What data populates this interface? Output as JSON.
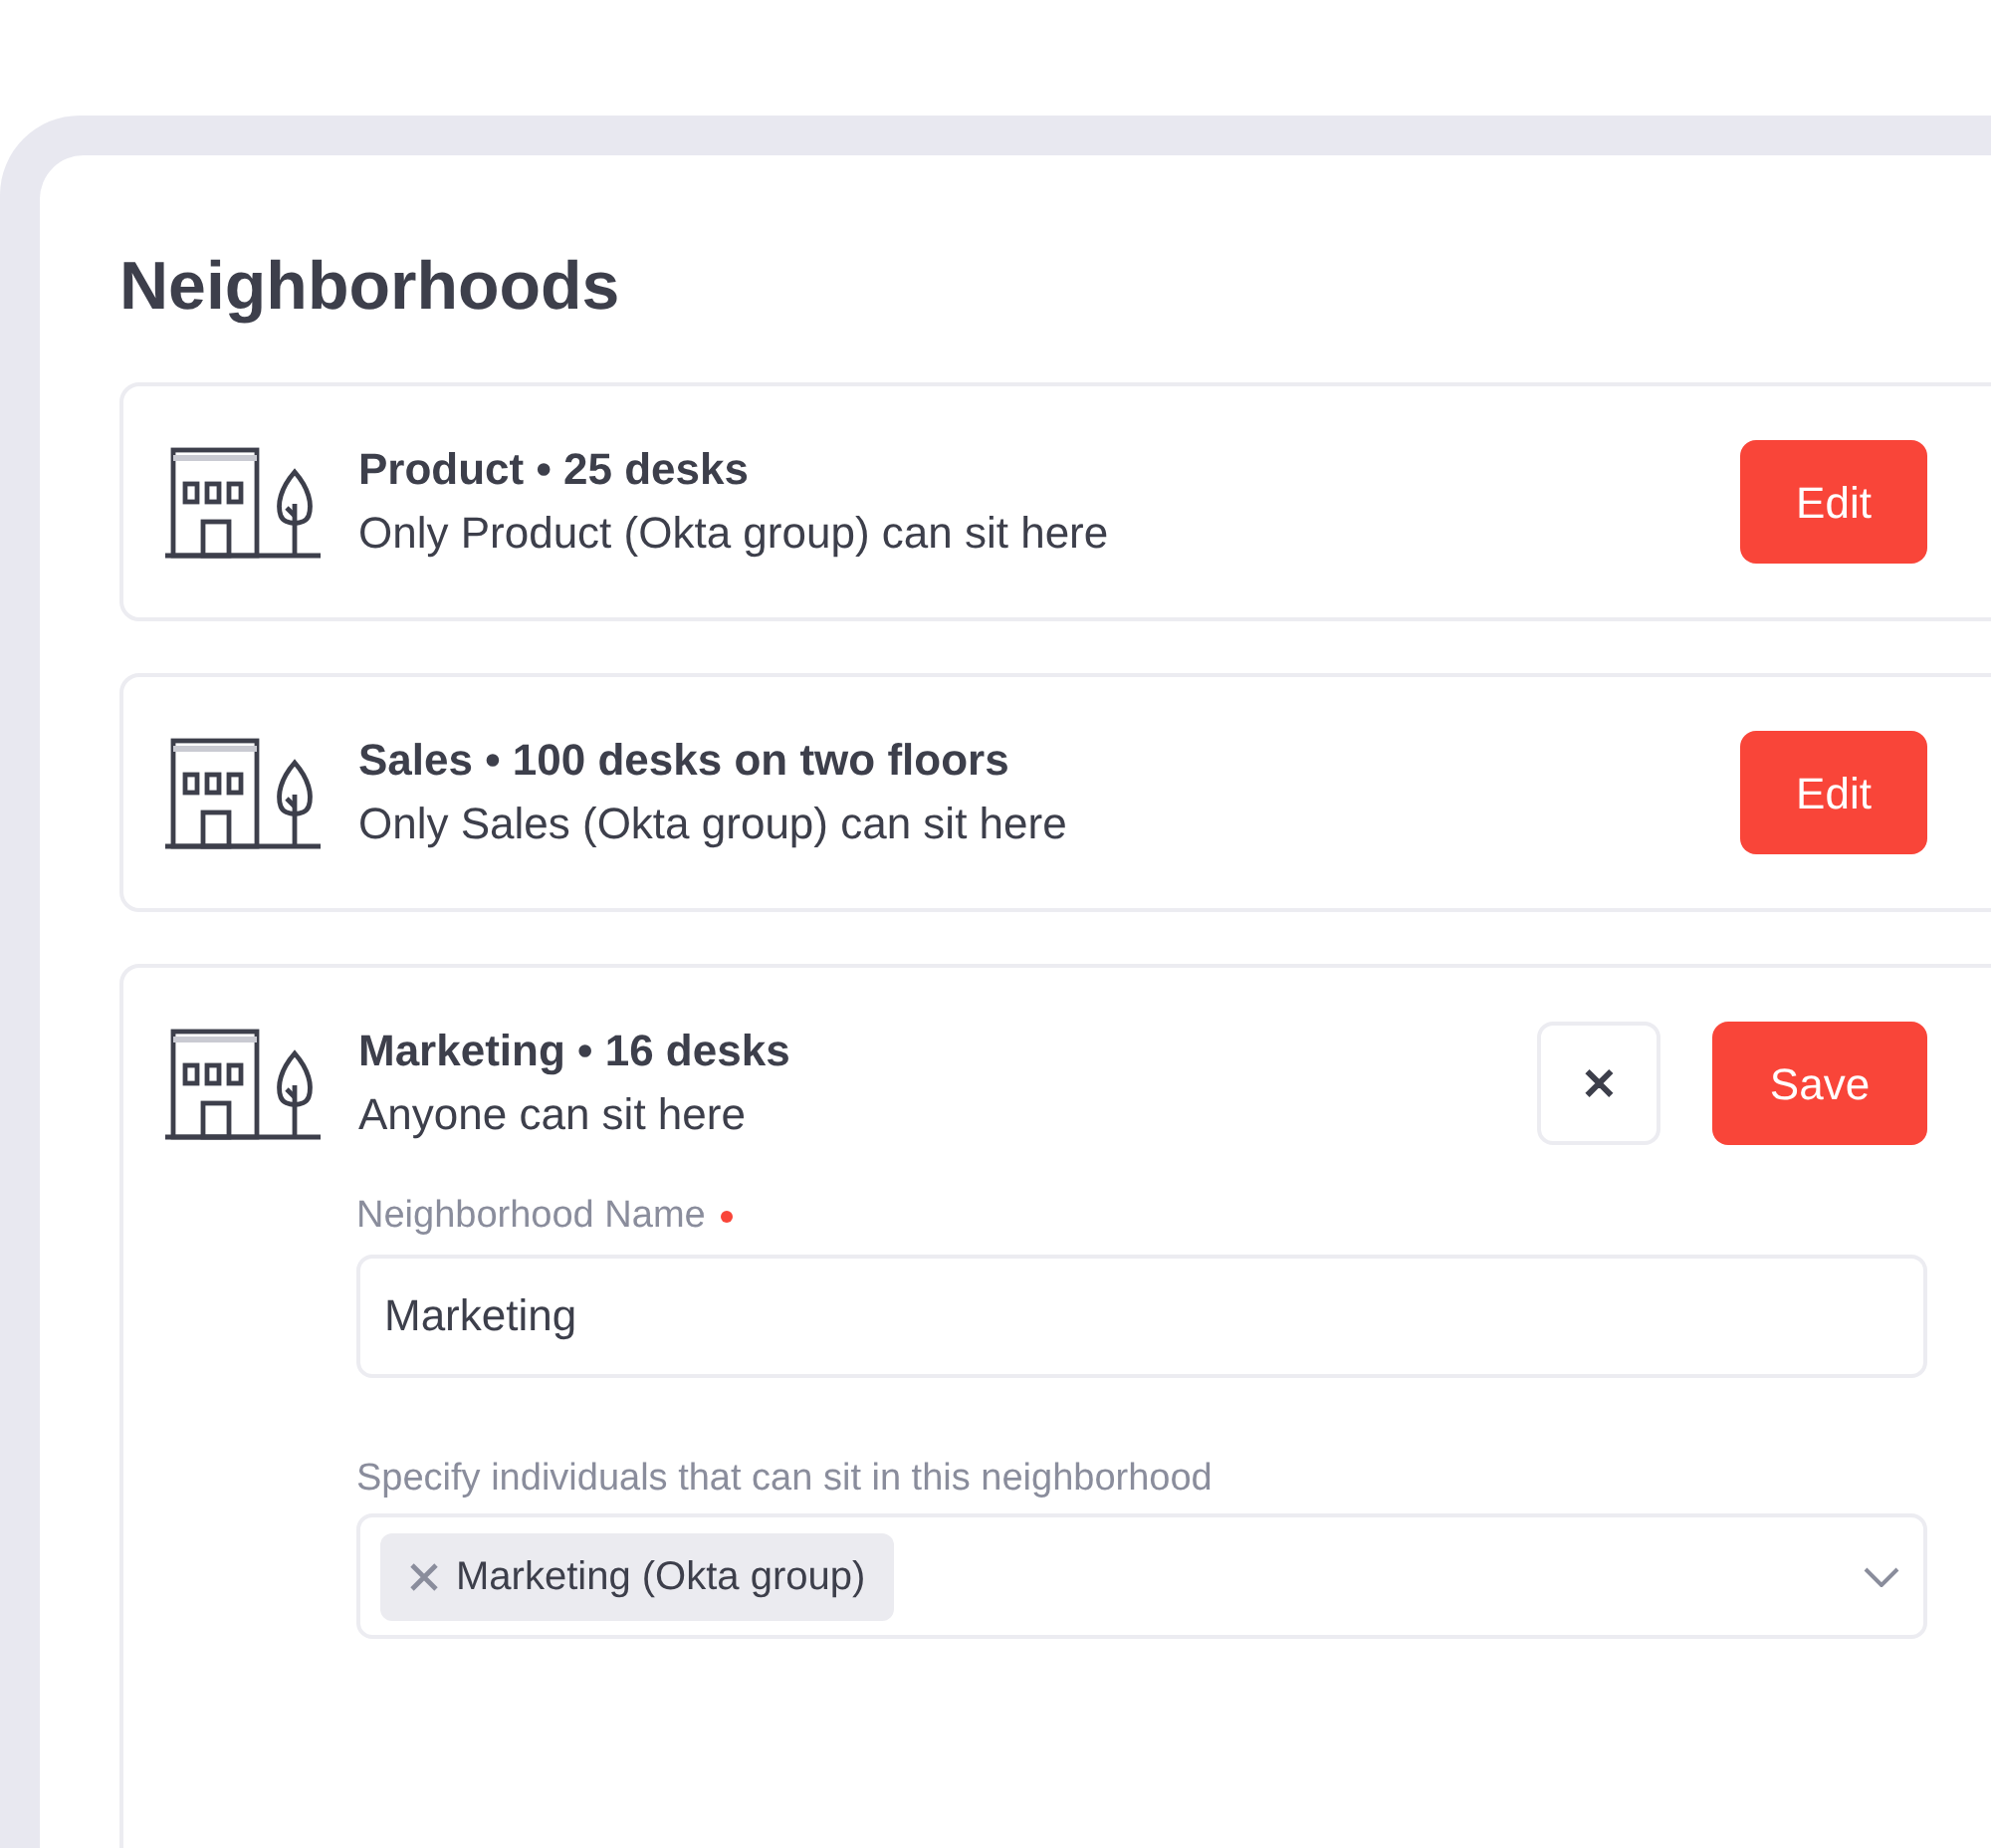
{
  "title": "Neighborhoods",
  "neighborhoods": [
    {
      "name": "Product • 25 desks",
      "access": "Only Product (Okta group) can sit here",
      "expanded": false,
      "edit_button": "Edit"
    },
    {
      "name": "Sales • 100 desks on two floors",
      "access": "Only Sales (Okta group) can sit here",
      "expanded": false,
      "edit_button": "Edit"
    },
    {
      "name": "Marketing • 16 desks",
      "access": "Anyone can sit here",
      "expanded": true,
      "cancel_button": "✕",
      "save_button": "Save",
      "form": {
        "name_label": "Neighborhood Name",
        "name_required": true,
        "name_value": "Marketing",
        "members_label": "Specify individuals that can sit in this neighborhood",
        "members": [
          {
            "label": "Marketing (Okta group)"
          }
        ]
      }
    }
  ]
}
